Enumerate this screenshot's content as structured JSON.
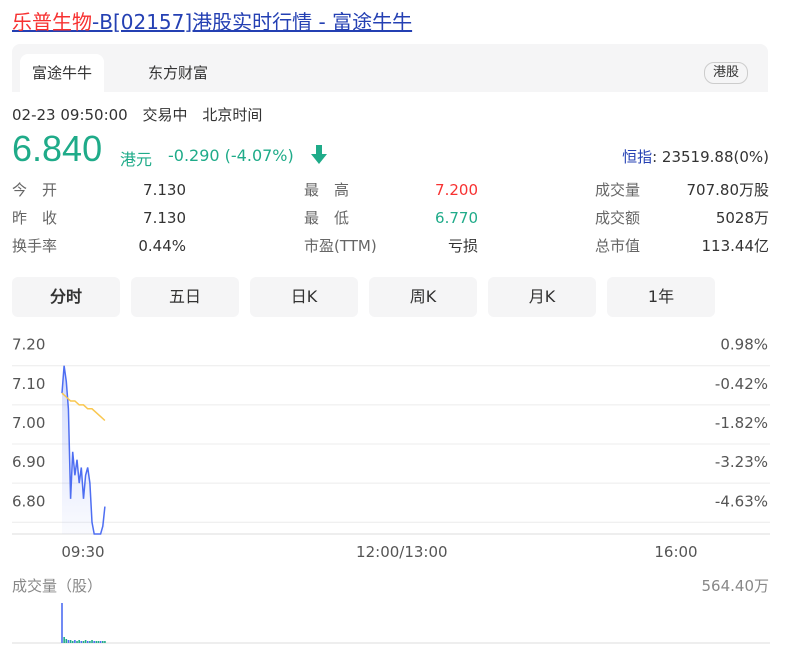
{
  "page": {
    "title_highlight": "乐普生物",
    "title_rest": "-B[02157]港股实时行情 - 富途牛牛"
  },
  "tabs": {
    "items": [
      "富途牛牛",
      "东方财富"
    ],
    "market_badge": "港股"
  },
  "quote": {
    "datetime": "02-23 09:50:00",
    "status": "交易中",
    "timezone": "北京时间",
    "price": "6.840",
    "currency": "港元",
    "change": "-0.290 (-4.07%)",
    "index_label": "恒指",
    "index_value": ": 23519.88(0%)",
    "stats": [
      {
        "label": "今　开",
        "value": "7.130"
      },
      {
        "label": "最　高",
        "value": "7.200"
      },
      {
        "label": "成交量",
        "value": "707.80万股"
      },
      {
        "label": "昨　收",
        "value": "7.130"
      },
      {
        "label": "最　低",
        "value": "6.770"
      },
      {
        "label": "成交额",
        "value": "5028万"
      },
      {
        "label": "换手率",
        "value": "0.44%"
      },
      {
        "label": "市盈(TTM)",
        "value": "亏损"
      },
      {
        "label": "总市值",
        "value": "113.44亿"
      }
    ]
  },
  "period_buttons": [
    "分时",
    "五日",
    "日K",
    "周K",
    "月K",
    "1年"
  ],
  "colors": {
    "up": "#f73131",
    "down": "#1fab89",
    "link": "#2440b3",
    "price_line": "#4e6ef2",
    "avg_line": "#f9c74f"
  },
  "chart_data": {
    "type": "line",
    "title": "",
    "y_ticks": [
      "7.20",
      "7.10",
      "7.00",
      "6.90",
      "6.80"
    ],
    "y_right_ticks": [
      "0.98%",
      "-0.42%",
      "-1.82%",
      "-3.23%",
      "-4.63%"
    ],
    "x_ticks": [
      "09:30",
      "12:00/13:00",
      "16:00"
    ],
    "ylim": [
      6.77,
      7.23
    ],
    "series": [
      {
        "x": [
          "09:30",
          "09:31",
          "09:32",
          "09:33",
          "09:34",
          "09:35",
          "09:36",
          "09:37",
          "09:38",
          "09:39",
          "09:40",
          "09:41",
          "09:42",
          "09:43",
          "09:44",
          "09:45",
          "09:46",
          "09:47",
          "09:48",
          "09:49",
          "09:50"
        ],
        "values": [
          7.13,
          7.2,
          7.16,
          7.09,
          6.86,
          6.98,
          6.92,
          6.96,
          6.9,
          6.94,
          6.86,
          6.92,
          6.94,
          6.9,
          6.8,
          6.77,
          6.77,
          6.77,
          6.77,
          6.79,
          6.84
        ]
      },
      {
        "x": [
          "09:30",
          "09:32",
          "09:34",
          "09:36",
          "09:38",
          "09:40",
          "09:42",
          "09:44",
          "09:46",
          "09:48",
          "09:50"
        ],
        "values": [
          7.13,
          7.12,
          7.11,
          7.11,
          7.1,
          7.1,
          7.09,
          7.09,
          7.08,
          7.07,
          7.06
        ]
      }
    ],
    "volume_label": "成交量（股）",
    "volume_max": "564.40万"
  }
}
